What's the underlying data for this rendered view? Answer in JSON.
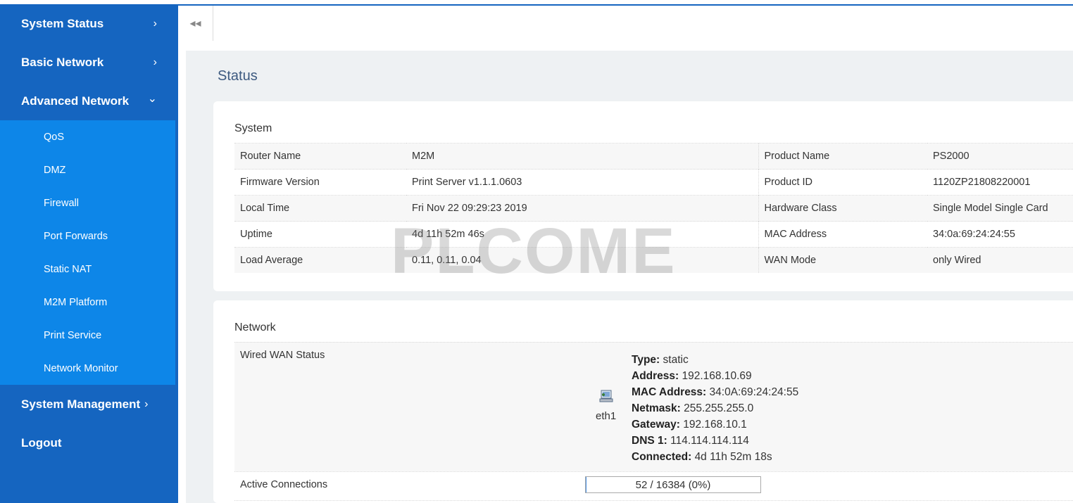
{
  "sidebar": {
    "items": [
      {
        "label": "System Status",
        "chevron": "›"
      },
      {
        "label": "Basic Network",
        "chevron": "›"
      },
      {
        "label": "Advanced Network",
        "chevron": "⌄"
      },
      {
        "label": "System Management",
        "chevron": "›"
      },
      {
        "label": "Logout"
      }
    ],
    "submenu": [
      "QoS",
      "DMZ",
      "Firewall",
      "Port Forwards",
      "Static NAT",
      "M2M Platform",
      "Print Service",
      "Network Monitor"
    ]
  },
  "topbar": {
    "collapse_icon": "double-left-arrow-icon",
    "collapse_glyph": "◂◂"
  },
  "page": {
    "title": "Status"
  },
  "system": {
    "title": "System",
    "rows": [
      {
        "k1": "Router Name",
        "v1": "M2M",
        "k2": "Product Name",
        "v2": "PS2000"
      },
      {
        "k1": "Firmware Version",
        "v1": "Print Server v1.1.1.0603",
        "k2": "Product ID",
        "v2": "1120ZP21808220001"
      },
      {
        "k1": "Local Time",
        "v1": "Fri Nov 22 09:29:23 2019",
        "k2": "Hardware Class",
        "v2": "Single Model Single Card"
      },
      {
        "k1": "Uptime",
        "v1": "4d 11h 52m 46s",
        "k2": "MAC Address",
        "v2": "34:0a:69:24:24:55"
      },
      {
        "k1": "Load Average",
        "v1": "0.11, 0.11, 0.04",
        "k2": "WAN Mode",
        "v2": "only Wired"
      }
    ]
  },
  "watermark": "PLCOME",
  "network": {
    "title": "Network",
    "wan_label": "Wired WAN Status",
    "interface": "eth1",
    "details": [
      {
        "key": "Type:",
        "value": "static"
      },
      {
        "key": "Address:",
        "value": "192.168.10.69"
      },
      {
        "key": "MAC Address:",
        "value": "34:0A:69:24:24:55"
      },
      {
        "key": "Netmask:",
        "value": "255.255.255.0"
      },
      {
        "key": "Gateway:",
        "value": "192.168.10.1"
      },
      {
        "key": "DNS 1:",
        "value": "114.114.114.114"
      },
      {
        "key": "Connected:",
        "value": "4d 11h 52m 18s"
      }
    ],
    "active_connections_label": "Active Connections",
    "active_connections_text": "52 / 16384 (0%)",
    "active_connections_fraction": 0.003
  }
}
